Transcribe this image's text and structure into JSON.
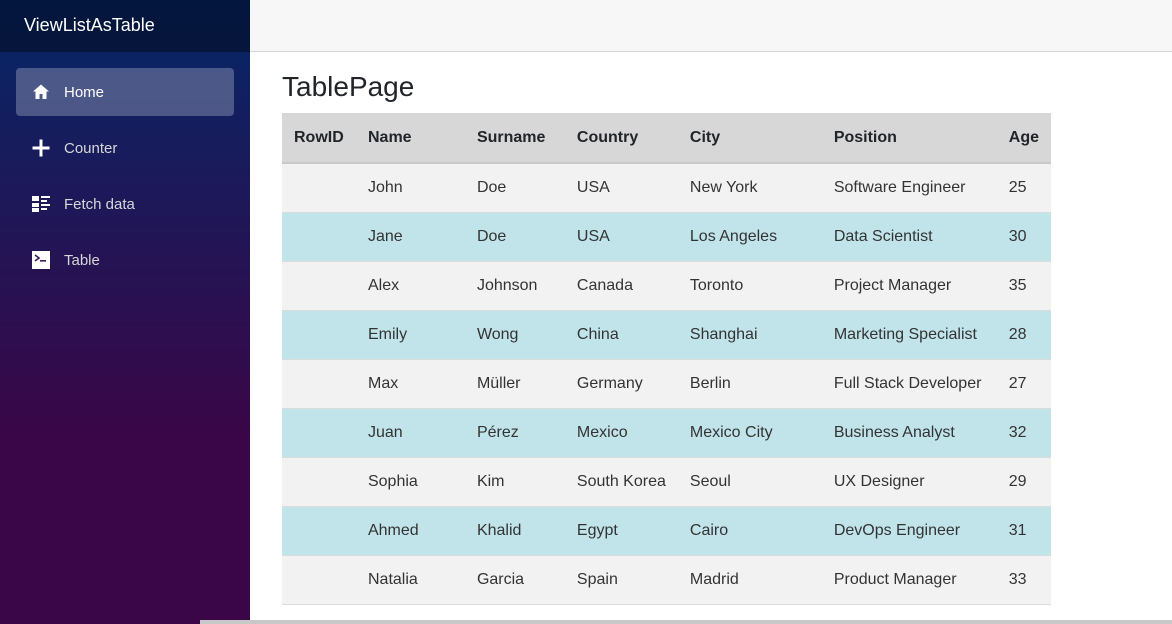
{
  "app": {
    "title": "ViewListAsTable"
  },
  "sidebar": {
    "items": [
      {
        "label": "Home",
        "icon": "home-icon",
        "active": true
      },
      {
        "label": "Counter",
        "icon": "plus-icon",
        "active": false
      },
      {
        "label": "Fetch data",
        "icon": "list-rich-icon",
        "active": false
      },
      {
        "label": "Table",
        "icon": "terminal-icon",
        "active": false
      }
    ]
  },
  "main": {
    "title": "TablePage",
    "table": {
      "headers": [
        "RowID",
        "Name",
        "Surname",
        "Country",
        "City",
        "Position",
        "Age"
      ],
      "rows": [
        [
          "",
          "John",
          "Doe",
          "USA",
          "New York",
          "Software Engineer",
          "25"
        ],
        [
          "",
          "Jane",
          "Doe",
          "USA",
          "Los Angeles",
          "Data Scientist",
          "30"
        ],
        [
          "",
          "Alex",
          "Johnson",
          "Canada",
          "Toronto",
          "Project Manager",
          "35"
        ],
        [
          "",
          "Emily",
          "Wong",
          "China",
          "Shanghai",
          "Marketing Specialist",
          "28"
        ],
        [
          "",
          "Max",
          "Müller",
          "Germany",
          "Berlin",
          "Full Stack Developer",
          "27"
        ],
        [
          "",
          "Juan",
          "Pérez",
          "Mexico",
          "Mexico City",
          "Business Analyst",
          "32"
        ],
        [
          "",
          "Sophia",
          "Kim",
          "South Korea",
          "Seoul",
          "UX Designer",
          "29"
        ],
        [
          "",
          "Ahmed",
          "Khalid",
          "Egypt",
          "Cairo",
          "DevOps Engineer",
          "31"
        ],
        [
          "",
          "Natalia",
          "Garcia",
          "Spain",
          "Madrid",
          "Product Manager",
          "33"
        ]
      ]
    }
  },
  "colors": {
    "sidebar_top": "#052767",
    "sidebar_bottom": "#3a0647",
    "row_odd": "#f2f2f2",
    "row_even": "#c0e4ea",
    "header_bg": "#d7d7d8"
  }
}
